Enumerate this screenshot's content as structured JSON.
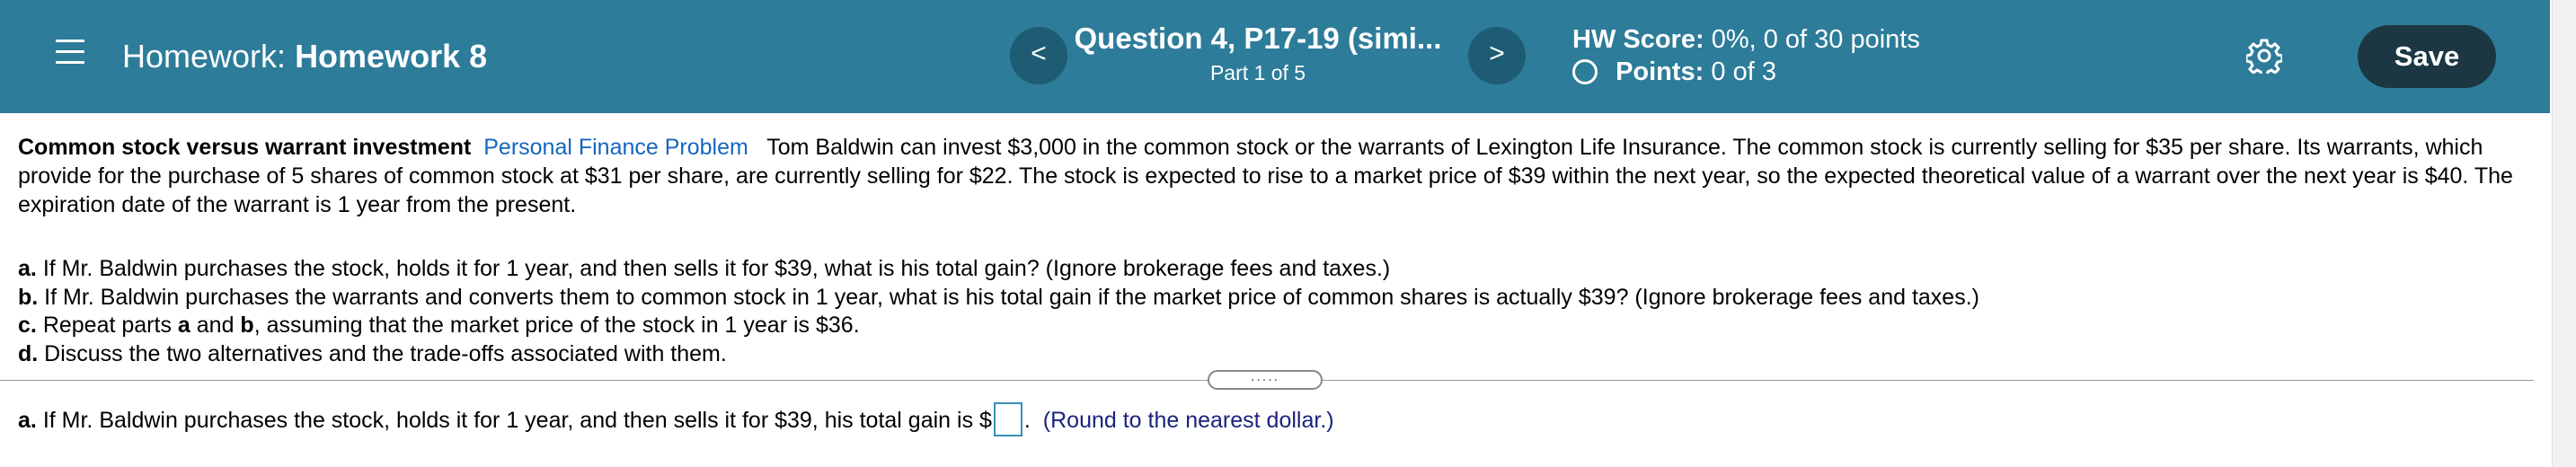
{
  "header": {
    "menu_icon": "hamburger-menu-icon",
    "hw_label": "Homework:",
    "hw_name": "Homework 8",
    "question_title": "Question 4, P17-19 (simi...",
    "question_part": "Part 1 of 5",
    "prev_icon": "<",
    "next_icon": ">",
    "hw_score_label": "HW Score:",
    "hw_score_value": "0%, 0 of 30 points",
    "points_label": "Points:",
    "points_value": "0 of 3",
    "settings_icon": "gear-icon",
    "save_label": "Save",
    "accent_color": "#2d7c99"
  },
  "problem": {
    "title": "Common stock versus warrant investment",
    "category_link": "Personal Finance Problem",
    "text": "Tom Baldwin can invest $3,000 in the common stock or the warrants of Lexington Life Insurance.  The common stock is currently selling for $35 per share.  Its warrants, which provide for the purchase of 5 shares of common stock at $31 per share, are currently selling for $22.  The stock is expected to rise to a market price of $39 within the next year, so the expected theoretical value of a warrant over the next year is $40.  The expiration date of the warrant is 1 year from the present.",
    "parts": [
      {
        "label": "a.",
        "text": "If Mr. Baldwin purchases the stock, holds it for 1 year, and then sells it for $39, what is his total gain?  (Ignore brokerage fees and taxes.)"
      },
      {
        "label": "b.",
        "text": "If Mr. Baldwin purchases the warrants and converts them to common stock in 1 year, what is his total gain if the market price of common shares is actually $39?  (Ignore brokerage fees and taxes.)"
      },
      {
        "label": "c.",
        "text_1": "Repeat parts ",
        "bold_a": "a",
        "text_2": " and ",
        "bold_b": "b",
        "text_3": ", assuming that the market price of the stock in 1 year is $36."
      },
      {
        "label": "d.",
        "text": "Discuss the two alternatives and the trade-offs associated with them."
      }
    ]
  },
  "divider": {
    "handle_text": "....."
  },
  "answer": {
    "label": "a.",
    "text": "If Mr. Baldwin purchases the stock, holds it for 1 year, and then sells it for $39, his total gain is $",
    "input_value": "",
    "period": ".",
    "note": "(Round to the nearest dollar.)"
  }
}
